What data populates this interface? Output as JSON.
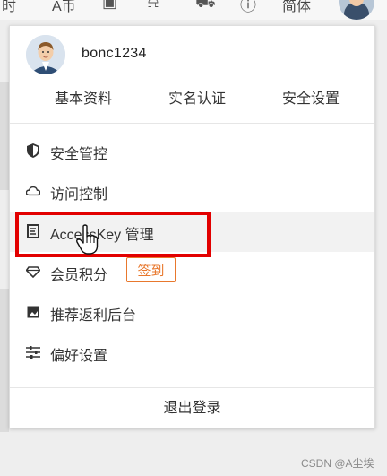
{
  "topbar": {
    "items": [
      "时",
      "A币",
      "简体"
    ]
  },
  "user": {
    "username": "bonc1234"
  },
  "quick_links": [
    "基本资料",
    "实名认证",
    "安全设置"
  ],
  "menu": [
    {
      "label": "安全管控",
      "icon": "shield-icon"
    },
    {
      "label": "访问控制",
      "icon": "cloud-icon"
    },
    {
      "label": "AccessKey 管理",
      "icon": "key-icon"
    },
    {
      "label": "会员积分",
      "icon": "diamond-icon",
      "badge": "签到"
    },
    {
      "label": "推荐返利后台",
      "icon": "image-icon"
    },
    {
      "label": "偏好设置",
      "icon": "sliders-icon"
    }
  ],
  "logout_label": "退出登录",
  "watermark": "CSDN @A尘埃",
  "colors": {
    "highlight_box": "#e20000",
    "badge": "#e8782d"
  }
}
